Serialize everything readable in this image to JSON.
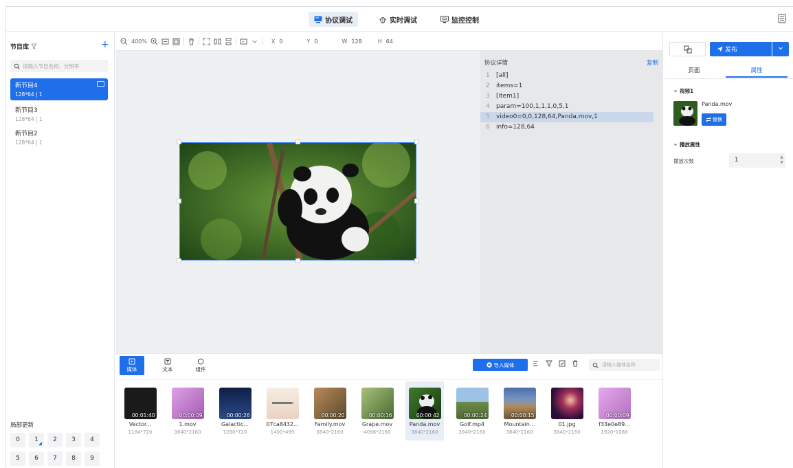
{
  "topbar": {
    "tabs": [
      {
        "label": "协议调试",
        "icon": "monitor-debug-icon",
        "active": true
      },
      {
        "label": "实时调试",
        "icon": "bug-icon",
        "active": false
      },
      {
        "label": "监控控制",
        "icon": "monitor-icon",
        "active": false
      }
    ]
  },
  "sidebar": {
    "title": "节目库",
    "search_placeholder": "请输入节目名称、分辨率",
    "programs": [
      {
        "name": "新节目4",
        "info": "128*64 | 1",
        "active": true
      },
      {
        "name": "新节目3",
        "info": "128*64 | 1",
        "active": false
      },
      {
        "name": "新节目2",
        "info": "128*64 | 1",
        "active": false
      }
    ],
    "partial_title": "局部更新",
    "numbers": [
      "0",
      "1",
      "2",
      "3",
      "4",
      "5",
      "6",
      "7",
      "8",
      "9"
    ]
  },
  "toolbar": {
    "zoom": "400%",
    "x_label": "X",
    "x_value": "0",
    "y_label": "Y",
    "y_value": "0",
    "w_label": "W",
    "w_value": "128",
    "h_label": "H",
    "h_value": "64"
  },
  "protocol": {
    "title": "协议详情",
    "copy_label": "复制",
    "lines": [
      {
        "no": "1",
        "text": "[all]"
      },
      {
        "no": "2",
        "text": "items=1"
      },
      {
        "no": "3",
        "text": "[item1]"
      },
      {
        "no": "4",
        "text": "param=100,1,1,1,0,5,1"
      },
      {
        "no": "5",
        "text": "video0=0,0,128,64,Panda.mov,1"
      },
      {
        "no": "6",
        "text": "info=128,64"
      }
    ],
    "highlight_index": 4
  },
  "media": {
    "tabs": [
      {
        "label": "媒体",
        "icon": "media-icon",
        "active": true
      },
      {
        "label": "文本",
        "icon": "text-icon",
        "active": false
      },
      {
        "label": "组件",
        "icon": "component-icon",
        "active": false
      }
    ],
    "import_label": "导入媒体",
    "search_placeholder": "请输入媒体名称",
    "items": [
      {
        "name": "Vector...",
        "size": "1184*720",
        "duration": "00:01:40",
        "bg": "#1a1a1a"
      },
      {
        "name": "1.mov",
        "size": "3840*2160",
        "duration": "00:00:09",
        "bg": "#c279c9"
      },
      {
        "name": "Galactic...",
        "size": "1280*720",
        "duration": "00:00:26",
        "bg": "#1b2c57"
      },
      {
        "name": "07ca8432...",
        "size": "1400*499",
        "duration": "",
        "bg": "#f3e4d8"
      },
      {
        "name": "Family.mov",
        "size": "3840*2160",
        "duration": "00:00:20",
        "bg": "#7a6a3e"
      },
      {
        "name": "Grape.mov",
        "size": "4096*2160",
        "duration": "00:00:16",
        "bg": "#6d8d4d"
      },
      {
        "name": "Panda.mov",
        "size": "3840*2160",
        "duration": "00:00:42",
        "bg": "#2d5a22",
        "selected": true
      },
      {
        "name": "Golf.mp4",
        "size": "3840*2160",
        "duration": "00:00:24",
        "bg": "#7ba3c9"
      },
      {
        "name": "Mountain...",
        "size": "3840*2160",
        "duration": "00:00:15",
        "bg": "#4d6a9c"
      },
      {
        "name": "01.jpg",
        "size": "3840*2160",
        "duration": "",
        "bg": "#3a1840"
      },
      {
        "name": "f33e0e89...",
        "size": "1920*1088",
        "duration": "00:00:09",
        "bg": "#c983cf"
      }
    ]
  },
  "right_panel": {
    "publish_label": "发布",
    "tabs": [
      {
        "label": "页面",
        "active": false
      },
      {
        "label": "属性",
        "active": true
      }
    ],
    "video_section": "视频1",
    "video_name": "Panda.mov",
    "replace_label": "替换",
    "play_section": "播放属性",
    "play_count_label": "播放次数",
    "play_count_value": "1"
  },
  "colors": {
    "accent": "#1f6fea",
    "highlight_line": "#cbd8ec",
    "canvas_bg": "#eff0f2",
    "protocol_bg": "#e7e8ea"
  }
}
